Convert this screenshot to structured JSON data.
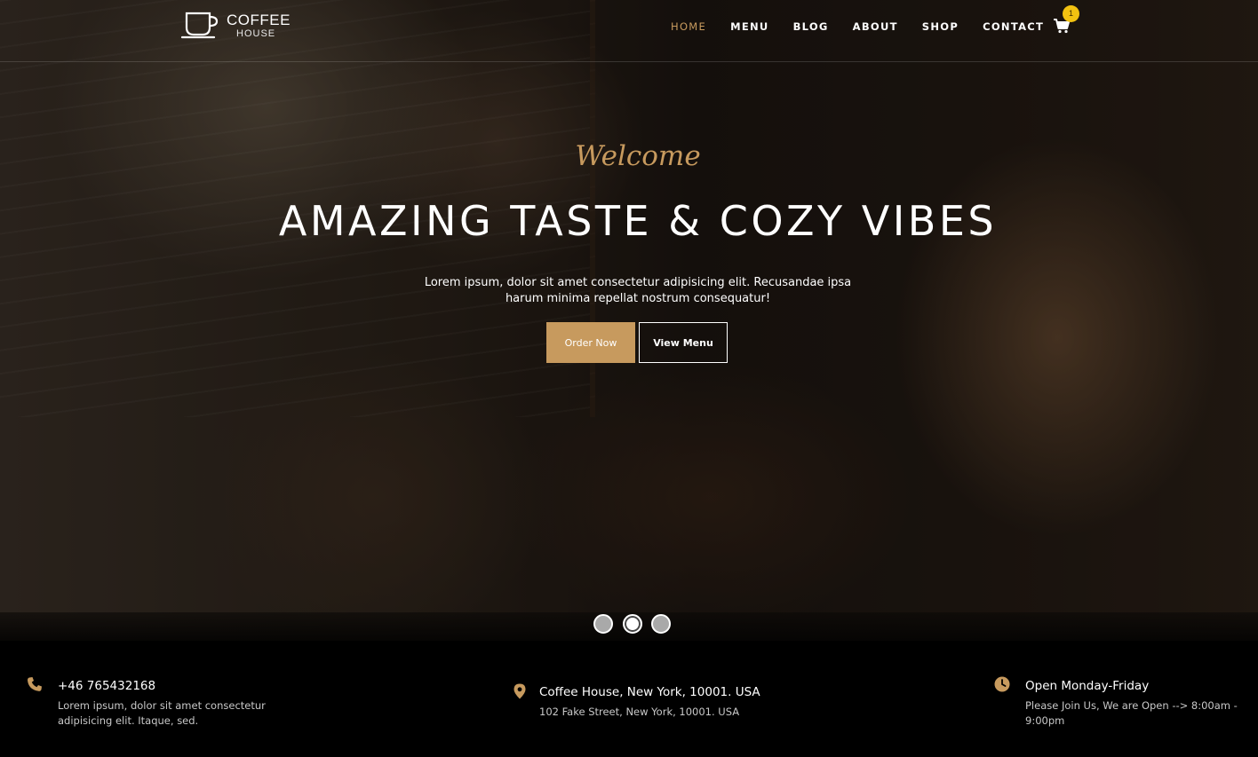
{
  "brand": {
    "line1": "COFFEE",
    "line2": "HOUSE"
  },
  "nav": {
    "items": [
      "HOME",
      "MENU",
      "BLOG",
      "ABOUT",
      "SHOP",
      "CONTACT"
    ],
    "active": "HOME",
    "cart_count": "1",
    "cart_icon": "shopping-cart-icon"
  },
  "hero": {
    "welcome": "Welcome",
    "headline": "AMAZING TASTE & COZY VIBES",
    "subtext": "Lorem ipsum, dolor sit amet consectetur adipisicing elit. Recusandae ipsa harum minima repellat nostrum consequatur!",
    "order_button": "Order Now",
    "view_button": "View Menu",
    "slide_count": 3,
    "active_slide": 2
  },
  "info": {
    "phone": {
      "icon": "phone-icon",
      "title": "+46 765432168",
      "text": "Lorem ipsum, dolor sit amet consectetur adipisicing elit. Itaque, sed."
    },
    "location": {
      "icon": "map-pin-icon",
      "title": "Coffee House, New York, 10001. USA",
      "text": "102 Fake Street, New York, 10001. USA"
    },
    "hours": {
      "icon": "clock-icon",
      "title": "Open Monday-Friday",
      "text": "Please Join Us, We are Open --> 8:00am - 9:00pm"
    }
  },
  "colors": {
    "accent": "#c79a5e",
    "badge": "#f2c211",
    "background": "#000000"
  }
}
